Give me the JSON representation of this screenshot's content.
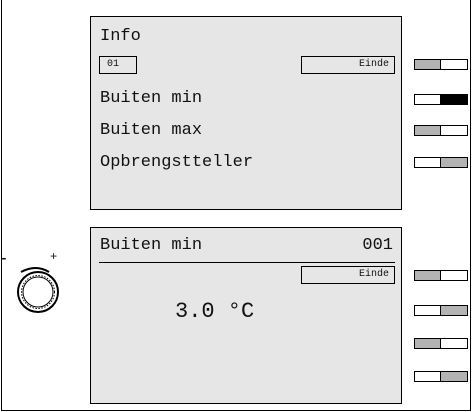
{
  "info_panel": {
    "title": "Info",
    "index": "01",
    "end_label": "Einde",
    "items": [
      "Buiten min",
      "Buiten max",
      "Opbrengstteller"
    ]
  },
  "detail_panel": {
    "title": "Buiten min",
    "code": "001",
    "end_label": "Einde",
    "value": "3.0 °C"
  },
  "knob": {
    "minus": "-",
    "plus": "+"
  },
  "colors": {
    "panel": "#e6e6e6",
    "switch_gray": "#b3b3b3",
    "switch_black": "#000000",
    "switch_white": "#ffffff"
  },
  "switches_top": [
    {
      "left": "gray",
      "right": "white"
    },
    {
      "left": "white",
      "right": "black"
    },
    {
      "left": "gray",
      "right": "white"
    },
    {
      "left": "white",
      "right": "gray"
    }
  ],
  "switches_bottom": [
    {
      "left": "gray",
      "right": "white"
    },
    {
      "left": "white",
      "right": "gray"
    },
    {
      "left": "gray",
      "right": "white"
    },
    {
      "left": "white",
      "right": "gray"
    }
  ]
}
